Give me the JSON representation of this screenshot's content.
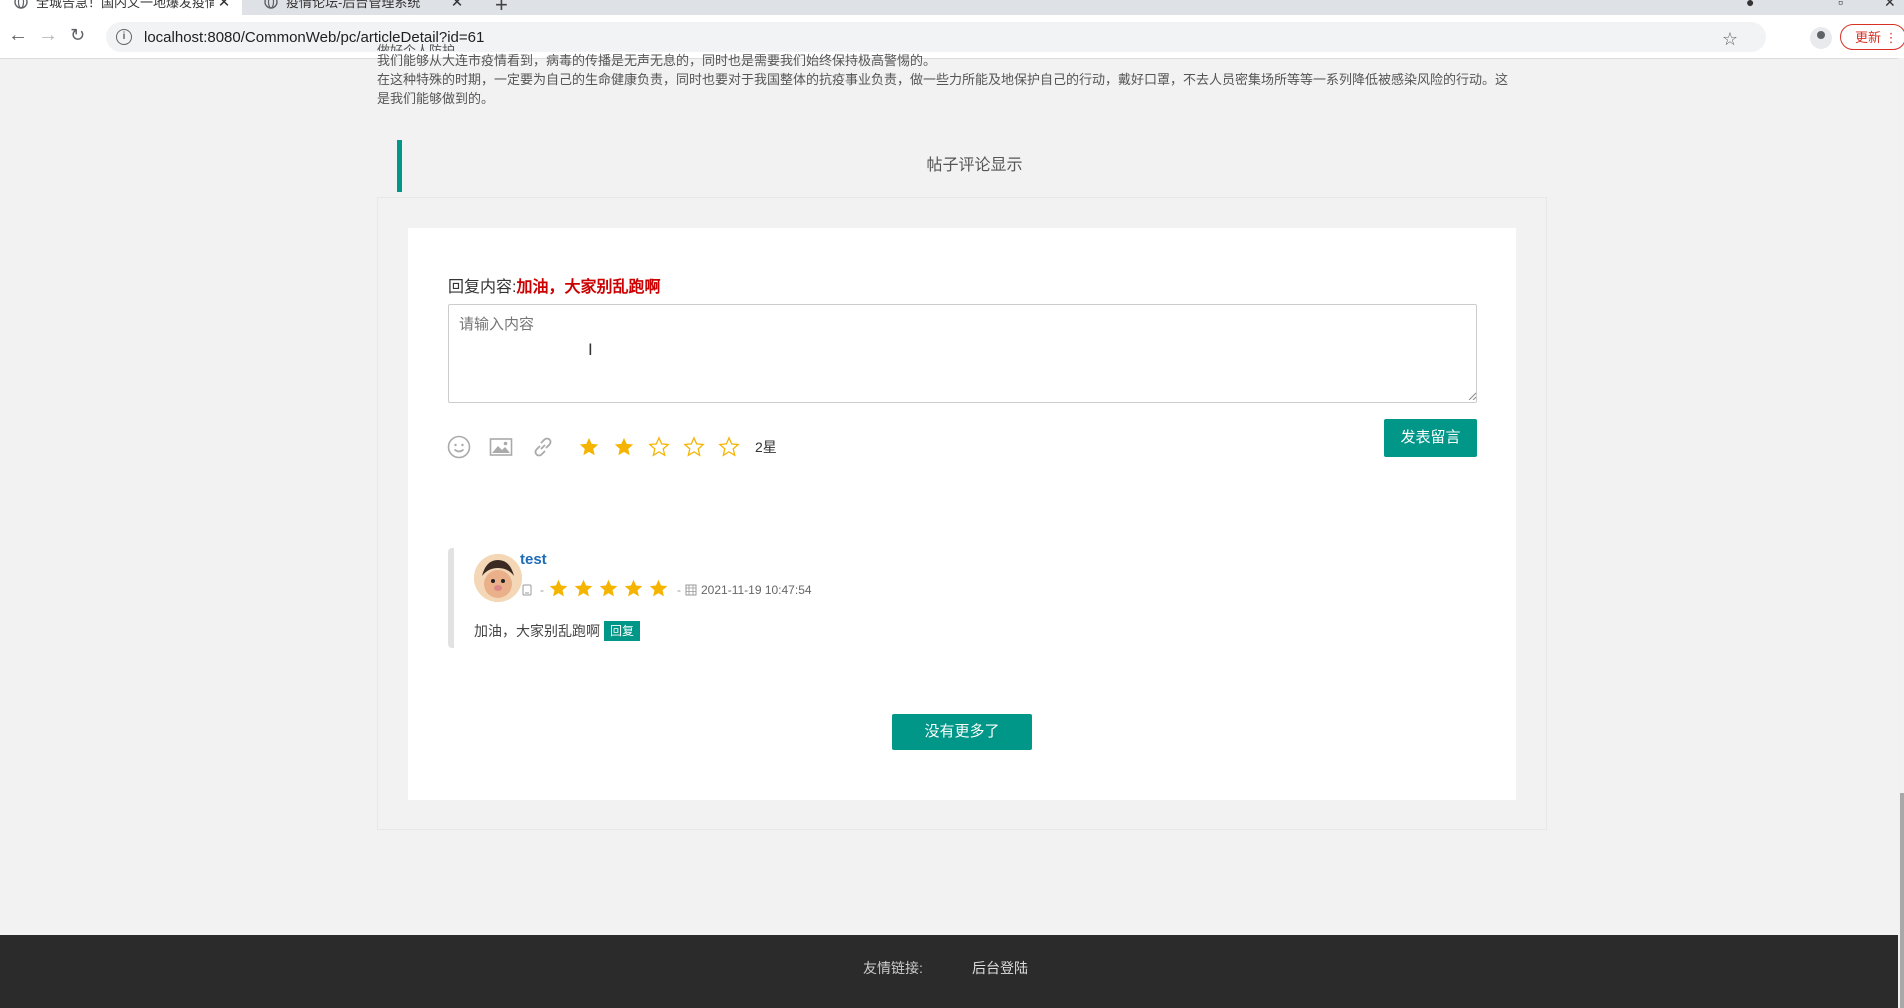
{
  "browser": {
    "tabs": [
      {
        "title": "全城告急！国内又一地爆发疫情…",
        "active": true
      },
      {
        "title": "疫情论坛-后台管理系统",
        "active": false
      }
    ],
    "url": "localhost:8080/CommonWeb/pc/articleDetail?id=61",
    "update_label": "更新"
  },
  "article": {
    "partial_line": "做好个人防护",
    "paragraphs": [
      "我们能够从大连市疫情看到，病毒的传播是无声无息的，同时也是需要我们始终保持极高警惕的。",
      "在这种特殊的时期，一定要为自己的生命健康负责，同时也要对于我国整体的抗疫事业负责，做一些力所能及地保护自己的行动，戴好口罩，不去人员密集场所等等一系列降低被感染风险的行动。这是我们能够做到的。"
    ]
  },
  "comments_section": {
    "title": "帖子评论显示",
    "reply_label": "回复内容:",
    "reply_target": "加油，大家别乱跑啊",
    "placeholder": "请输入内容",
    "rating_text": "2星",
    "rating": 2,
    "rating_max": 5,
    "submit_label": "发表留言",
    "comments": [
      {
        "username": "test",
        "rating": 5,
        "dash": "-",
        "timestamp": "2021-11-19 10:47:54",
        "content": "加油，大家别乱跑啊",
        "reply_label": "回复"
      }
    ],
    "more_label": "没有更多了"
  },
  "footer": {
    "links_label": "友情链接:",
    "admin_link": "后台登陆"
  },
  "colors": {
    "accent": "#009688",
    "star": "#f5b400",
    "reply_target": "#cc0000",
    "username": "#1e6bb8",
    "footer_bg": "#2b2b2b"
  },
  "icons": [
    "globe-icon",
    "close-icon",
    "back-icon",
    "forward-icon",
    "reload-icon",
    "info-icon",
    "bookmark-star-icon",
    "profile-icon",
    "emoji-icon",
    "image-icon",
    "link-icon",
    "star-icon",
    "device-icon",
    "calendar-icon",
    "text-cursor-icon"
  ]
}
